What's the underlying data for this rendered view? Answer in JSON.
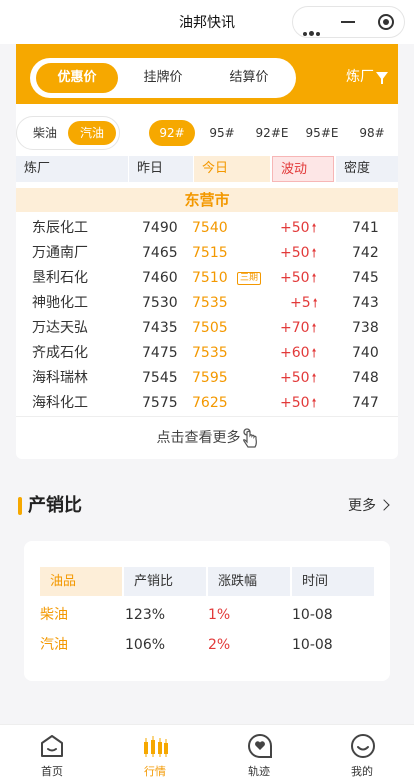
{
  "window": {
    "title": "油邦快讯"
  },
  "price_tabs": [
    {
      "label": "优惠价",
      "active": true
    },
    {
      "label": "挂牌价",
      "active": false
    },
    {
      "label": "结算价",
      "active": false
    }
  ],
  "refinery_filter": {
    "label": "炼厂"
  },
  "fuel_types": [
    {
      "label": "柴油",
      "active": false
    },
    {
      "label": "汽油",
      "active": true
    }
  ],
  "grades": [
    {
      "label": "92#",
      "active": true
    },
    {
      "label": "95#",
      "active": false
    },
    {
      "label": "92#E",
      "active": false
    },
    {
      "label": "95#E",
      "active": false
    },
    {
      "label": "98#",
      "active": false
    }
  ],
  "table": {
    "headers": {
      "refinery": "炼厂",
      "yesterday": "昨日",
      "today": "今日",
      "change": "波动",
      "density": "密度"
    },
    "city": "东营市",
    "rows": [
      {
        "name": "东辰化工",
        "yesterday": "7490",
        "today": "7540",
        "tag": "",
        "change": "+50",
        "density": "741"
      },
      {
        "name": "万通南厂",
        "yesterday": "7465",
        "today": "7515",
        "tag": "",
        "change": "+50",
        "density": "742"
      },
      {
        "name": "垦利石化",
        "yesterday": "7460",
        "today": "7510",
        "tag": "三期",
        "change": "+50",
        "density": "745"
      },
      {
        "name": "神驰化工",
        "yesterday": "7530",
        "today": "7535",
        "tag": "",
        "change": "+5",
        "density": "743"
      },
      {
        "name": "万达天弘",
        "yesterday": "7435",
        "today": "7505",
        "tag": "",
        "change": "+70",
        "density": "738"
      },
      {
        "name": "齐成石化",
        "yesterday": "7475",
        "today": "7535",
        "tag": "",
        "change": "+60",
        "density": "740"
      },
      {
        "name": "海科瑞林",
        "yesterday": "7545",
        "today": "7595",
        "tag": "",
        "change": "+50",
        "density": "748"
      },
      {
        "name": "海科化工",
        "yesterday": "7575",
        "today": "7625",
        "tag": "",
        "change": "+50",
        "density": "747"
      }
    ],
    "more_label": "点击查看更多"
  },
  "production_sales": {
    "title": "产销比",
    "more_label": "更多",
    "headers": [
      "油品",
      "产销比",
      "涨跌幅",
      "时间"
    ],
    "rows": [
      {
        "product": "柴油",
        "ratio": "123%",
        "change": "1%",
        "date": "10-08"
      },
      {
        "product": "汽油",
        "ratio": "106%",
        "change": "2%",
        "date": "10-08"
      }
    ]
  },
  "tabbar": [
    {
      "label": "首页",
      "icon": "home-icon",
      "active": false
    },
    {
      "label": "行情",
      "icon": "candlestick-icon",
      "active": true
    },
    {
      "label": "轨迹",
      "icon": "chat-icon",
      "active": false
    },
    {
      "label": "我的",
      "icon": "profile-icon",
      "active": false
    }
  ],
  "colors": {
    "accent": "#f6a800",
    "up": "#e23a3a"
  }
}
